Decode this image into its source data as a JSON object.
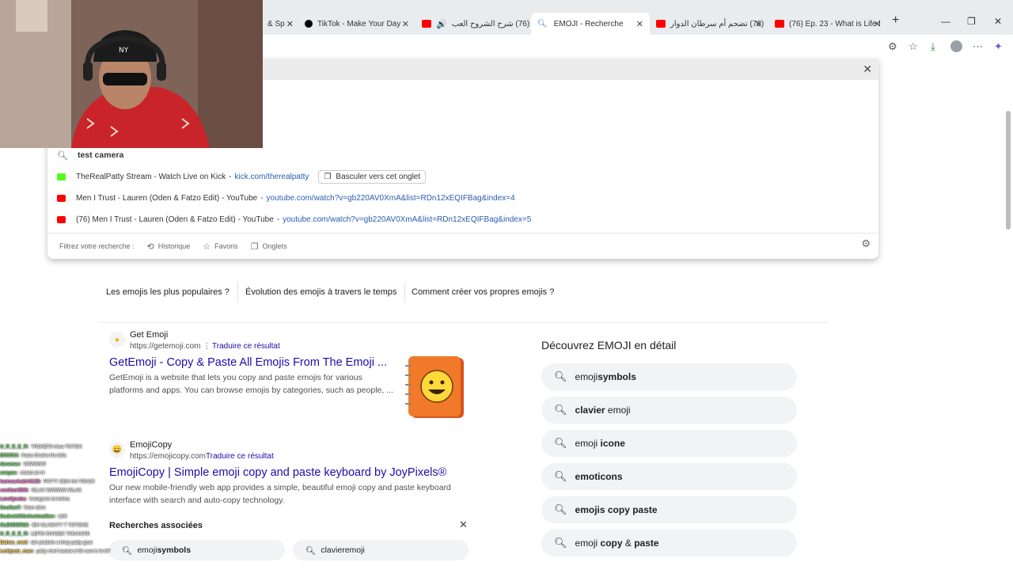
{
  "tabs": [
    {
      "label": "& Sp",
      "favicon_color": "#ff4500"
    },
    {
      "label": "TikTok - Make Your Day",
      "favicon_color": "#000000"
    },
    {
      "label": "(76) شرح الشروح العب",
      "favicon_color": "#ff0000"
    },
    {
      "label": "EMOJI - Recherche",
      "favicon_color": "#1a73e8",
      "active": true
    },
    {
      "label": "(76) تضحم أم سرطان الدوار",
      "favicon_color": "#ff0000"
    },
    {
      "label": "(76) Ep. 23 - What is Life l",
      "favicon_color": "#ff0000"
    }
  ],
  "omnibox": {
    "query": "test camera",
    "suggestions": [
      {
        "title": "TheRealPatty Stream - Watch Live on Kick",
        "separator": "-",
        "url": "kick.com/therealpatty",
        "favicon_color": "#53fc18",
        "switch_label": "Basculer vers cet onglet"
      },
      {
        "title": "Men I Trust - Lauren (Oden & Fatzo Edit) - YouTube",
        "separator": "-",
        "url": "youtube.com/watch?v=gb220AV0XmA&list=RDn12xEQIFBag&index=4",
        "favicon_color": "#ff0000"
      },
      {
        "title": "(76) Men I Trust - Lauren (Oden & Fatzo Edit) - YouTube",
        "separator": "-",
        "url": "youtube.com/watch?v=gb220AV0XmA&list=RDn12xEQIFBag&index=5",
        "favicon_color": "#ff0000"
      }
    ],
    "filter_label": "Filtrez votre recherche :",
    "filters": [
      "Historique",
      "Favoris",
      "Onglets"
    ]
  },
  "chips": [
    "Les emojis les plus populaires ?",
    "Évolution des emojis à travers le temps",
    "Comment créer vos propres emojis ?"
  ],
  "results": [
    {
      "site_name": "Get Emoji",
      "site_url": "https://getemoji.com",
      "translate": "Traduire ce résultat",
      "title": "GetEmoji - Copy & Paste All Emojis From The Emoji ...",
      "snippet": "GetEmoji is a website that lets you copy and paste emojis for various platforms and apps. You can browse emojis by categories, such as people, ..."
    },
    {
      "site_name": "EmojiCopy",
      "site_url": "https://emojicopy.com",
      "translate": "Traduire ce résultat",
      "title": "EmojiCopy | Simple emoji copy and paste keyboard by JoyPixels®",
      "snippet": "Our new mobile-friendly web app provides a simple, beautiful emoji copy and paste keyboard interface with search and auto-copy technology."
    }
  ],
  "related": {
    "heading": "Recherches associées",
    "items": [
      {
        "normal": "emoji ",
        "bold": "symbols"
      },
      {
        "normal": "",
        "bold": "clavier",
        "suffix": " emoji"
      }
    ]
  },
  "discover": {
    "title": "Découvrez EMOJI en détail",
    "items": [
      {
        "pre": "emoji ",
        "bold": "symbols",
        "post": ""
      },
      {
        "pre": "",
        "bold": "clavier",
        "post": " emoji"
      },
      {
        "pre": "emoji ",
        "bold": "icone",
        "post": ""
      },
      {
        "pre": "",
        "bold": "emoticons",
        "post": ""
      },
      {
        "pre": "",
        "bold": "emojis copy paste",
        "post": ""
      },
      {
        "pre": "emoji ",
        "bold": "copy",
        "post": " & ",
        "bold2": "paste"
      }
    ]
  },
  "chat": [
    {
      "user": "U_R_E_E_R:",
      "msg": "TROSETA rhea TIKTOK",
      "color": "#6fe36f"
    },
    {
      "user": "BO3013:",
      "msg": "lhaza Gnaha Ha lalfa",
      "color": "#6fe36f"
    },
    {
      "user": "daramas:",
      "msg": "WWWWW",
      "color": "#6fe36f"
    },
    {
      "user": "zenpax:",
      "msg": "chahd ah hi",
      "color": "#6fe36f"
    },
    {
      "user": "hamzachabir6135:",
      "msg": "PATTY 3IEH HA TRACK",
      "color": "#ff7bd5"
    },
    {
      "user": "soufian4555:",
      "msg": "WLAK WWWWA WLAK",
      "color": "#ff7bd5"
    },
    {
      "user": "Lmehjouba:",
      "msg": "Instagram la kelma",
      "color": "#ff7bd5"
    },
    {
      "user": "Soufian7:",
      "msg": "fhem drtm",
      "color": "#6fe36f"
    },
    {
      "user": "Dudeshillthefootmailker:",
      "msg": "LES",
      "color": "#6fe36f"
    },
    {
      "user": "SLENDER22:",
      "msg": "IEH SLASHTY T TIKTOKE",
      "color": "#6fe36f"
    },
    {
      "user": "U_R_E_E_R:",
      "msg": "LEFIS KHASEK TAKAHANI",
      "color": "#6fe36f"
    },
    {
      "user": "Dahso_med:",
      "msg": "tah ykalbek a khay patty goat",
      "color": "#ffd24d"
    },
    {
      "user": "Lmhjoub_man:",
      "msg": "patty chef trackat d 50 cent b IA 60'",
      "color": "#ffd24d"
    }
  ],
  "colors": {
    "link": "#1a0dab",
    "url_green": "#2a5db0",
    "pill_bg": "#f1f3f4"
  }
}
